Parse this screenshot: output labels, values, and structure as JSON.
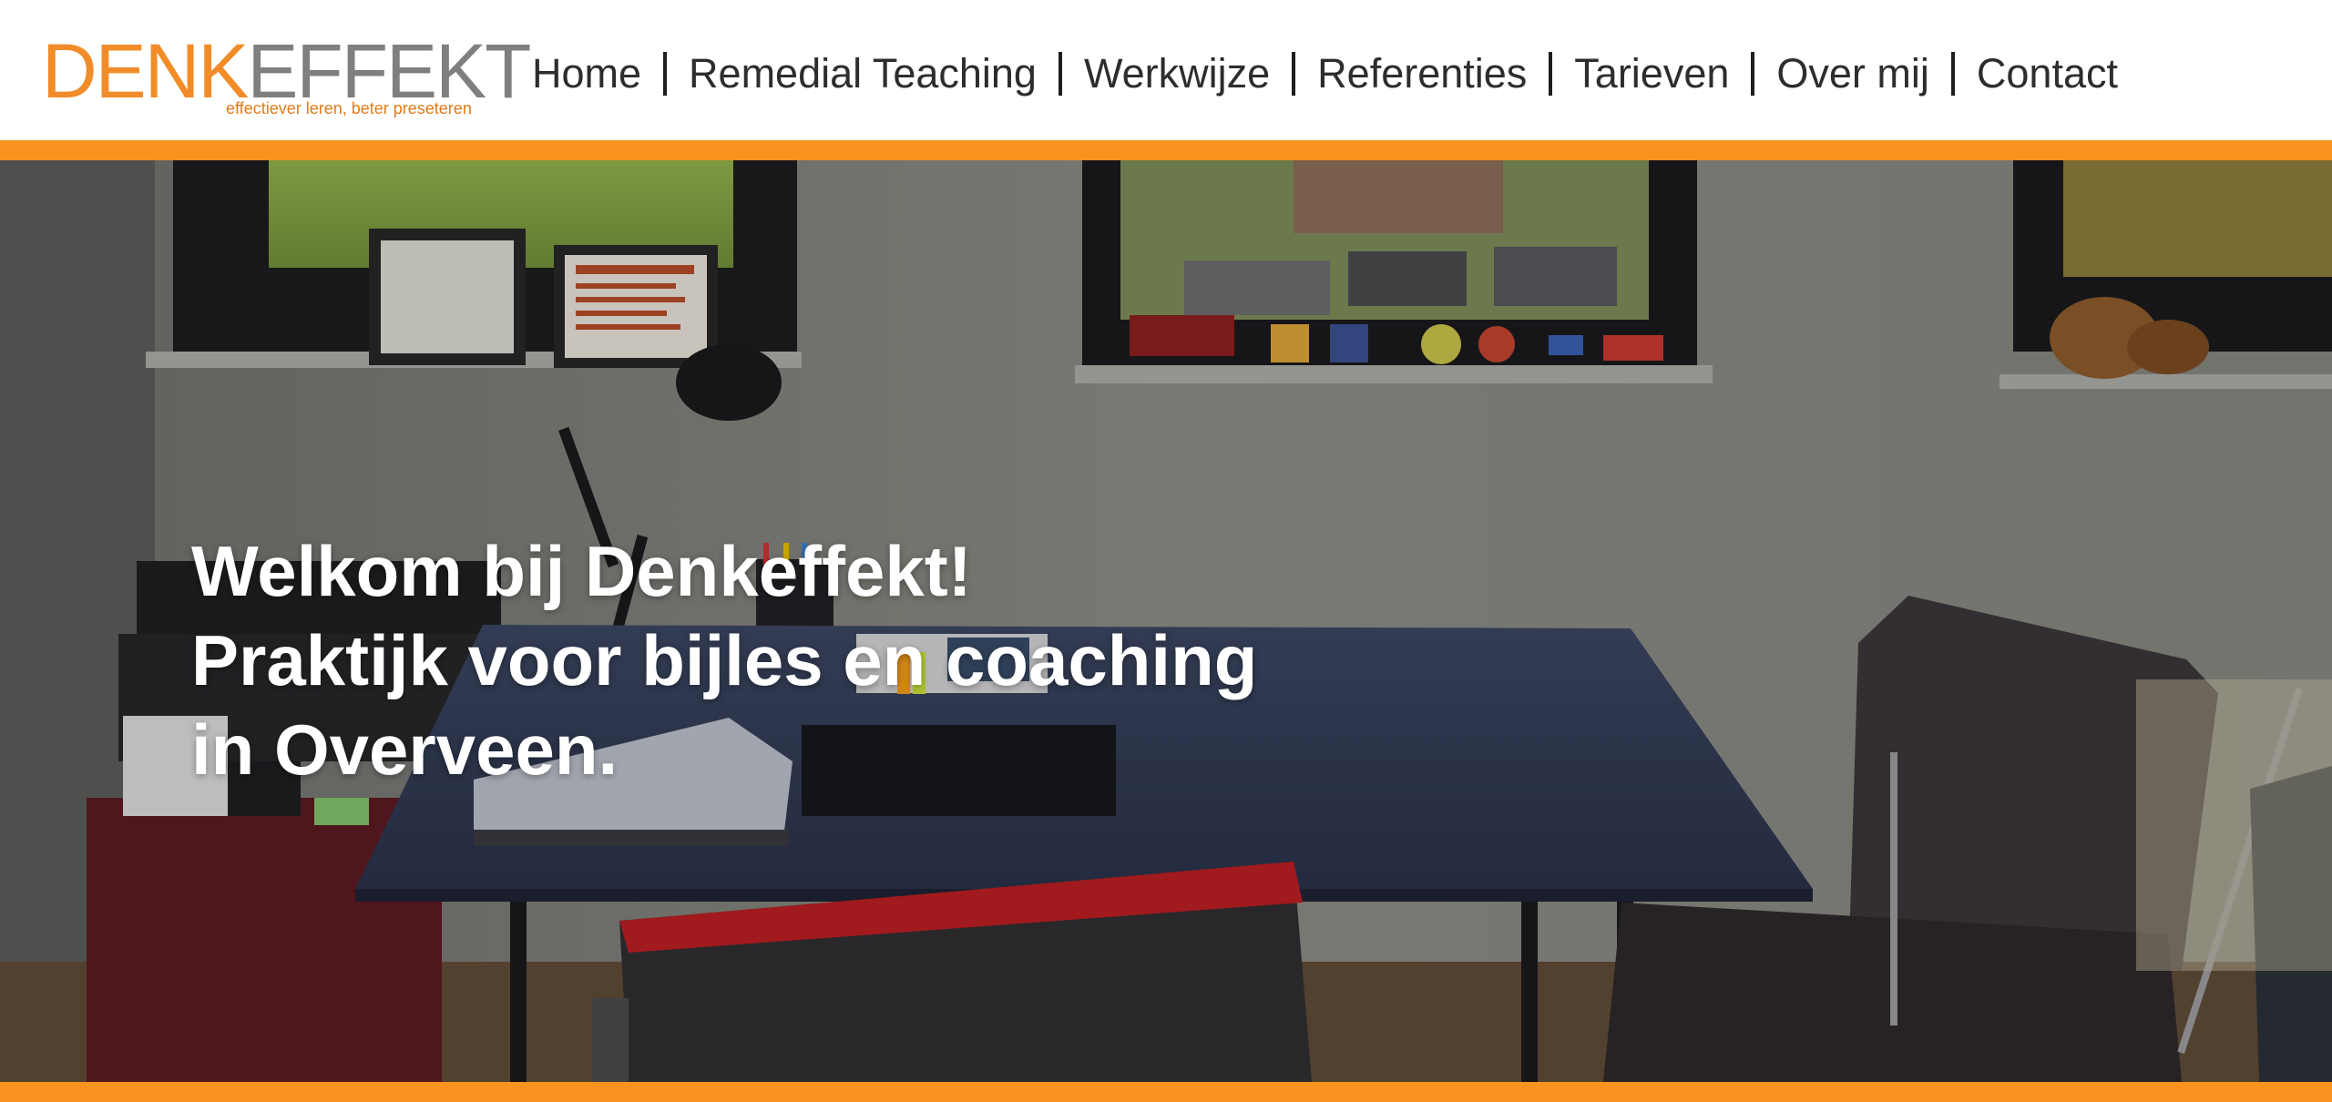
{
  "brand": {
    "logo_part1": "DENK",
    "logo_part2": "EFFEKT",
    "tagline": "effectiever leren, beter preseteren",
    "accent_color": "#f7931e",
    "logo_orange": "#f28c28",
    "logo_gray": "#7f7f7f"
  },
  "nav": {
    "items": [
      {
        "label": "Home"
      },
      {
        "label": "Remedial Teaching"
      },
      {
        "label": "Werkwijze"
      },
      {
        "label": "Referenties"
      },
      {
        "label": "Tarieven"
      },
      {
        "label": "Over mij"
      },
      {
        "label": "Contact"
      }
    ]
  },
  "hero": {
    "lines": [
      "Welkom bij Denkeffekt!",
      "Praktijk voor bijles en coaching",
      "in Overveen."
    ]
  }
}
